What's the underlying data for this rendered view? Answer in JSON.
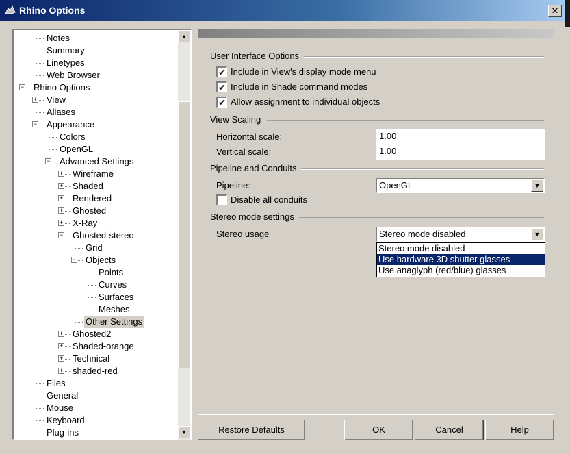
{
  "window": {
    "title": "Rhino Options",
    "close_glyph": "✕"
  },
  "tree": {
    "items": [
      {
        "label": "Notes",
        "indent": 2,
        "expander": ""
      },
      {
        "label": "Summary",
        "indent": 2,
        "expander": ""
      },
      {
        "label": "Linetypes",
        "indent": 2,
        "expander": ""
      },
      {
        "label": "Web Browser",
        "indent": 2,
        "expander": ""
      },
      {
        "label": "Rhino Options",
        "indent": 1,
        "expander": "−"
      },
      {
        "label": "View",
        "indent": 2,
        "expander": "+"
      },
      {
        "label": "Aliases",
        "indent": 2,
        "expander": ""
      },
      {
        "label": "Appearance",
        "indent": 2,
        "expander": "−"
      },
      {
        "label": "Colors",
        "indent": 3,
        "expander": ""
      },
      {
        "label": "OpenGL",
        "indent": 3,
        "expander": ""
      },
      {
        "label": "Advanced Settings",
        "indent": 3,
        "expander": "−"
      },
      {
        "label": "Wireframe",
        "indent": 4,
        "expander": "+"
      },
      {
        "label": "Shaded",
        "indent": 4,
        "expander": "+"
      },
      {
        "label": "Rendered",
        "indent": 4,
        "expander": "+"
      },
      {
        "label": "Ghosted",
        "indent": 4,
        "expander": "+"
      },
      {
        "label": "X-Ray",
        "indent": 4,
        "expander": "+"
      },
      {
        "label": "Ghosted-stereo",
        "indent": 4,
        "expander": "−"
      },
      {
        "label": "Grid",
        "indent": 5,
        "expander": ""
      },
      {
        "label": "Objects",
        "indent": 5,
        "expander": "−"
      },
      {
        "label": "Points",
        "indent": 6,
        "expander": ""
      },
      {
        "label": "Curves",
        "indent": 6,
        "expander": ""
      },
      {
        "label": "Surfaces",
        "indent": 6,
        "expander": ""
      },
      {
        "label": "Meshes",
        "indent": 6,
        "expander": ""
      },
      {
        "label": "Other Settings",
        "indent": 5,
        "expander": "",
        "selected": true
      },
      {
        "label": "Ghosted2",
        "indent": 4,
        "expander": "+"
      },
      {
        "label": "Shaded-orange",
        "indent": 4,
        "expander": "+"
      },
      {
        "label": "Technical",
        "indent": 4,
        "expander": "+"
      },
      {
        "label": "shaded-red",
        "indent": 4,
        "expander": "+"
      },
      {
        "label": "Files",
        "indent": 2,
        "expander": ""
      },
      {
        "label": "General",
        "indent": 2,
        "expander": ""
      },
      {
        "label": "Mouse",
        "indent": 2,
        "expander": ""
      },
      {
        "label": "Keyboard",
        "indent": 2,
        "expander": ""
      },
      {
        "label": "Plug-ins",
        "indent": 2,
        "expander": ""
      }
    ],
    "scroll_up_glyph": "▲",
    "scroll_down_glyph": "▼"
  },
  "ui_options": {
    "heading": "User Interface Options",
    "include_display_mode_menu": {
      "label": "Include in View's display mode menu",
      "checked": true
    },
    "include_shade_command": {
      "label": "Include in Shade command modes",
      "checked": true
    },
    "allow_individual_objects": {
      "label": "Allow assignment to individual objects",
      "checked": true
    }
  },
  "view_scaling": {
    "heading": "View Scaling",
    "horizontal_label": "Horizontal scale:",
    "horizontal_value": "1.00",
    "vertical_label": "Vertical scale:",
    "vertical_value": "1.00"
  },
  "pipeline": {
    "heading": "Pipeline and Conduits",
    "pipeline_label": "Pipeline:",
    "pipeline_value": "OpenGL",
    "disable_conduits_label": "Disable all conduits",
    "disable_conduits_checked": false
  },
  "stereo": {
    "heading": "Stereo mode settings",
    "usage_label": "Stereo usage",
    "usage_value": "Stereo mode disabled",
    "options": [
      {
        "label": "Stereo mode disabled",
        "highlighted": false
      },
      {
        "label": "Use hardware 3D shutter glasses",
        "highlighted": true
      },
      {
        "label": "Use anaglyph (red/blue) glasses",
        "highlighted": false
      }
    ]
  },
  "buttons": {
    "restore_defaults": "Restore Defaults",
    "ok": "OK",
    "cancel": "Cancel",
    "help": "Help"
  },
  "glyphs": {
    "check": "✔",
    "dropdown_arrow": "▼"
  },
  "colors": {
    "selection": "#0a246a",
    "dialog_bg": "#d4d0c8"
  }
}
